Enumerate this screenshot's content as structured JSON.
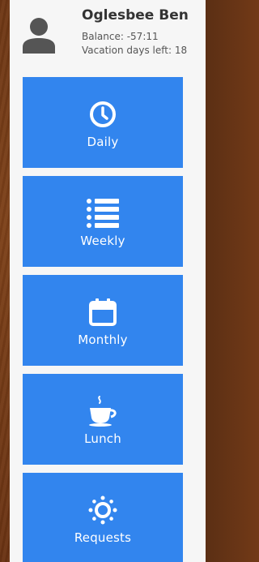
{
  "user": {
    "name": "Oglesbee Ben",
    "balance": "Balance: -57:11",
    "vacation": "Vacation days left: 18"
  },
  "nav": [
    {
      "label": "Daily",
      "icon": "clock-icon"
    },
    {
      "label": "Weekly",
      "icon": "list-icon"
    },
    {
      "label": "Monthly",
      "icon": "calendar-icon"
    },
    {
      "label": "Lunch",
      "icon": "coffee-cup-icon"
    },
    {
      "label": "Requests",
      "icon": "sun-icon"
    }
  ],
  "colors": {
    "accent": "#3285ee",
    "panel": "#f6f6f6",
    "text": "#333333"
  }
}
